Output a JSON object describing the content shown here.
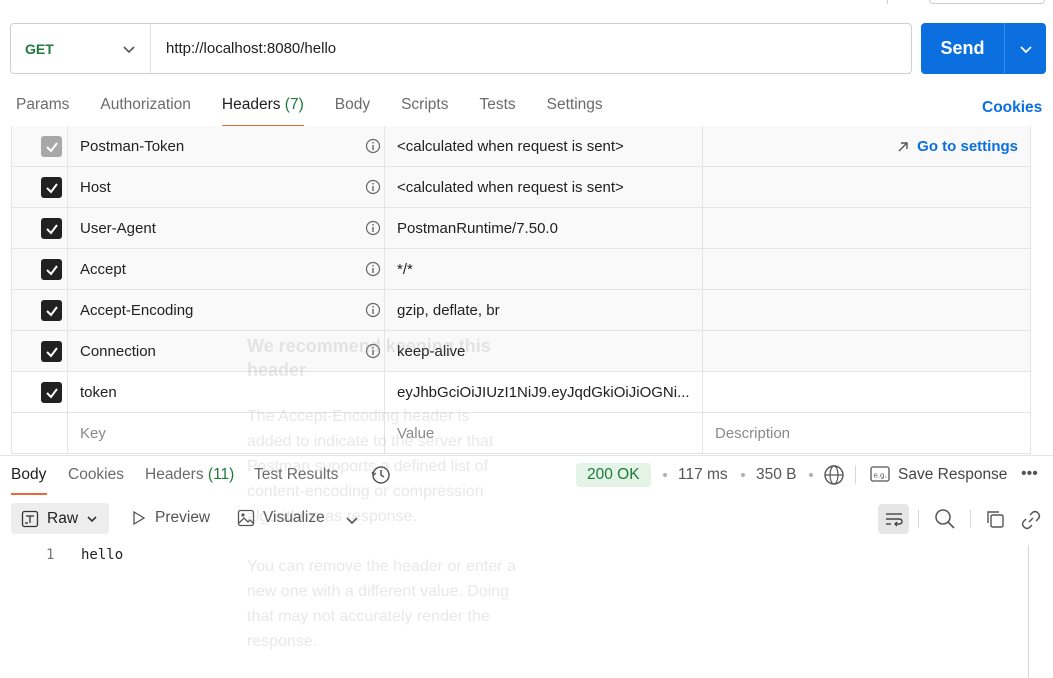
{
  "request": {
    "method": "GET",
    "url": "http://localhost:8080/hello",
    "send_label": "Send"
  },
  "request_tabs": {
    "params": "Params",
    "authorization": "Authorization",
    "headers": "Headers",
    "headers_count": "(7)",
    "body": "Body",
    "scripts": "Scripts",
    "tests": "Tests",
    "settings": "Settings",
    "cookies": "Cookies"
  },
  "headers_table": {
    "rows": [
      {
        "key": "Postman-Token",
        "value": "<calculated when request is sent>"
      },
      {
        "key": "Host",
        "value": "<calculated when request is sent>"
      },
      {
        "key": "User-Agent",
        "value": "PostmanRuntime/7.50.0"
      },
      {
        "key": "Accept",
        "value": "*/*"
      },
      {
        "key": "Accept-Encoding",
        "value": "gzip, deflate, br"
      },
      {
        "key": "Connection",
        "value": "keep-alive"
      },
      {
        "key": "token",
        "value": "eyJhbGciOiJIUzI1NiJ9.eyJqdGkiOiJiOGNi..."
      }
    ],
    "go_to_settings": "Go to settings",
    "placeholder_key": "Key",
    "placeholder_value": "Value",
    "placeholder_description": "Description"
  },
  "tooltip_ghost": {
    "title": "We recommend keeping this header",
    "para1": "The Accept-Encoding header is added to indicate to the server that Postman supports a defined list of content-encoding or compression algorithms as response.",
    "para2": "You can remove the header or enter a new one with a different value. Doing that may not accurately render the response."
  },
  "response": {
    "tabs": {
      "body": "Body",
      "cookies": "Cookies",
      "headers": "Headers",
      "headers_count": "(11)",
      "test_results": "Test Results"
    },
    "status": "200 OK",
    "time": "117 ms",
    "size": "350 B",
    "save_response": "Save Response",
    "view_mode": "Raw",
    "preview": "Preview",
    "visualize": "Visualize",
    "line_number": "1",
    "body_text": "hello"
  },
  "colors": {
    "accent": "#0b6fe0",
    "method_green": "#1f7a3c",
    "tab_underline": "#e8673c",
    "status_bg": "#e3f4e6"
  }
}
